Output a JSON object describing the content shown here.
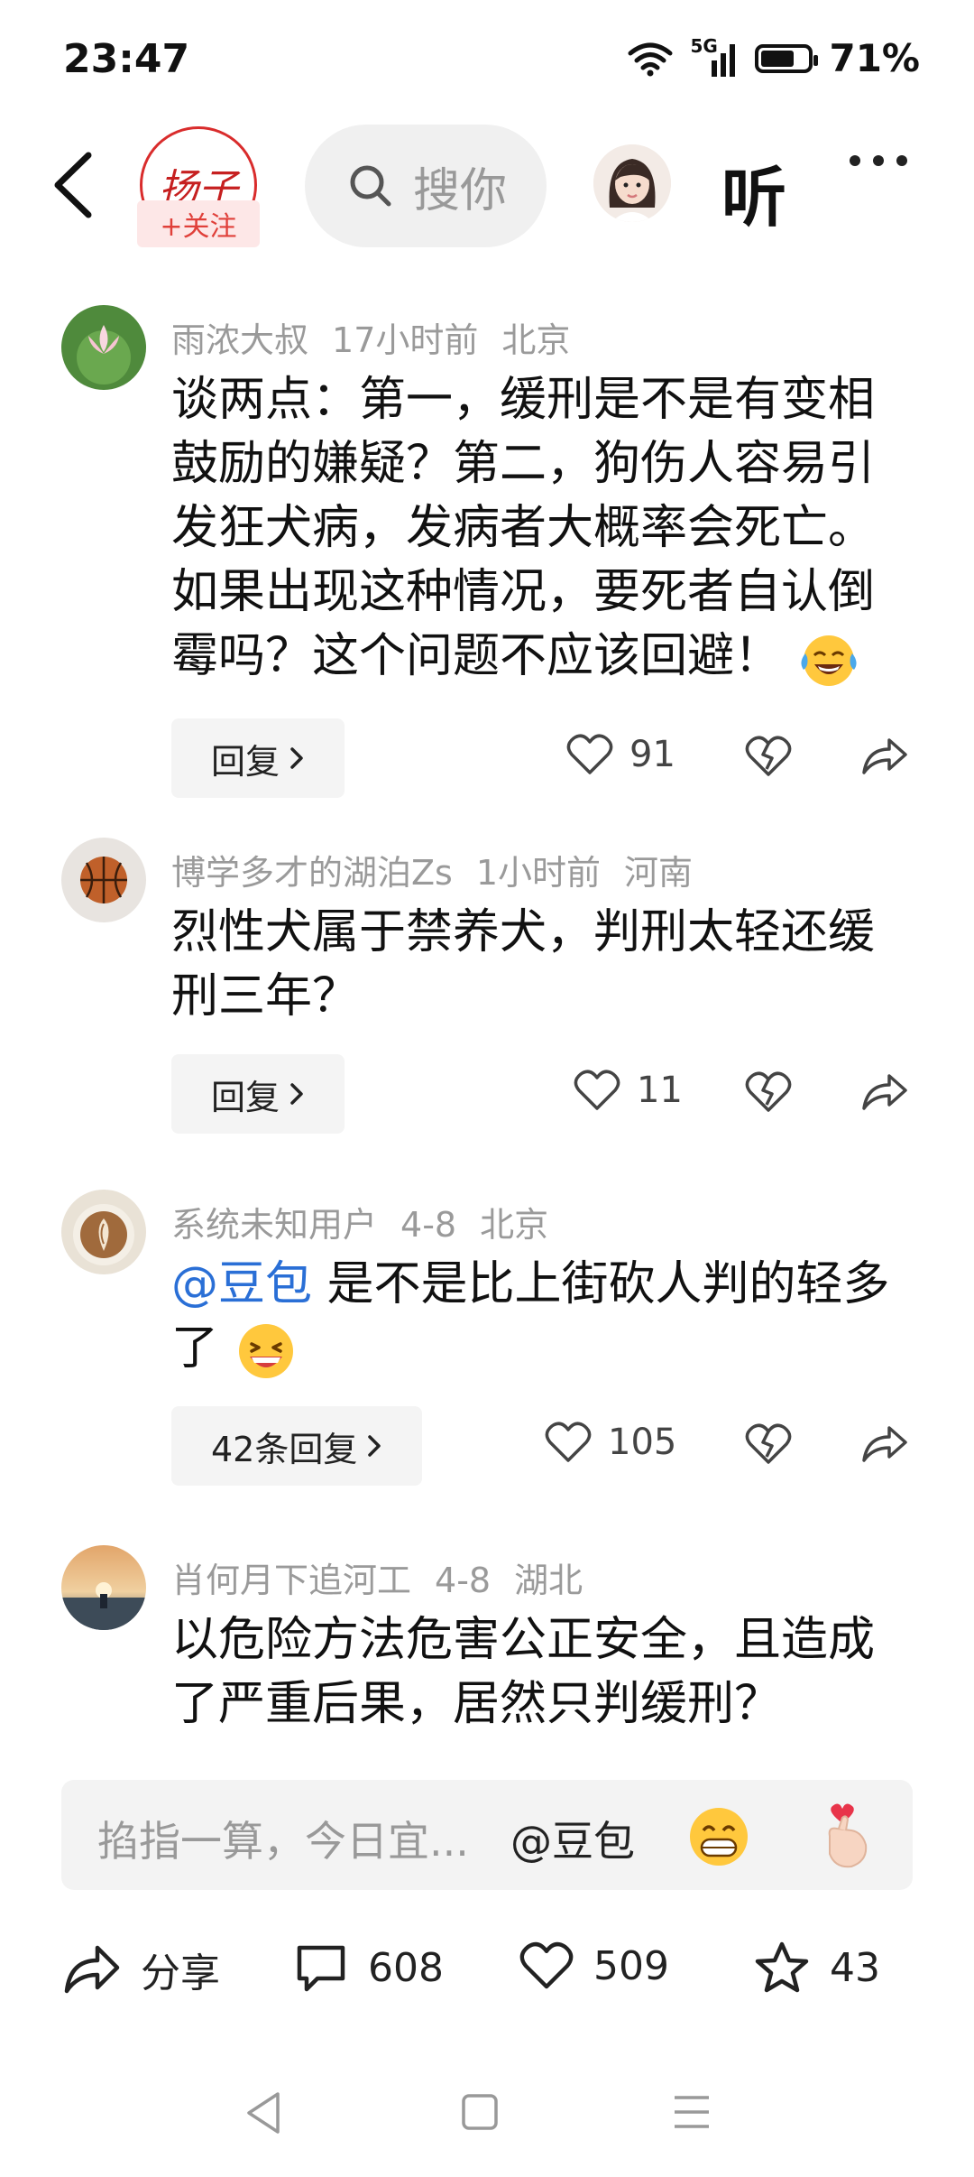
{
  "status_bar": {
    "time": "23:47",
    "network": "5G",
    "battery": "71%",
    "battery_level": 0.71
  },
  "header": {
    "logo_text": "扬子",
    "follow_label": "+关注",
    "search_placeholder": "搜你",
    "listen_label": "听"
  },
  "comments": [
    {
      "user": "雨浓大叔",
      "time": "17小时前",
      "location": "北京",
      "text": "谈两点：第一，缓刑是不是有变相鼓励的嫌疑？第二，狗伤人容易引发狂犬病，发病者大概率会死亡。如果出现这种情况，要死者自认倒霉吗？这个问题不应该回避！",
      "reply_label": "回复",
      "likes": "91"
    },
    {
      "user": "博学多才的湖泊Zs",
      "time": "1小时前",
      "location": "河南",
      "text": "烈性犬属于禁养犬，判刑太轻还缓刑三年？",
      "reply_label": "回复",
      "likes": "11"
    },
    {
      "user": "系统未知用户",
      "time": "4-8",
      "location": "北京",
      "mention": "@豆包",
      "text": " 是不是比上街砍人判的轻多了",
      "reply_label": "42条回复",
      "likes": "105"
    },
    {
      "user": "肖何月下追河工",
      "time": "4-8",
      "location": "湖北",
      "text": "以危险方法危害公正安全，且造成了严重后果，居然只判缓刑？"
    }
  ],
  "input": {
    "placeholder": "掐指一算，今日宜...",
    "mention": "@豆包"
  },
  "actions": {
    "share_label": "分享",
    "comments": "608",
    "likes": "509",
    "favorites": "43"
  },
  "colors": {
    "accent_red": "#e0403a",
    "mention_blue": "#2a6fd6"
  }
}
